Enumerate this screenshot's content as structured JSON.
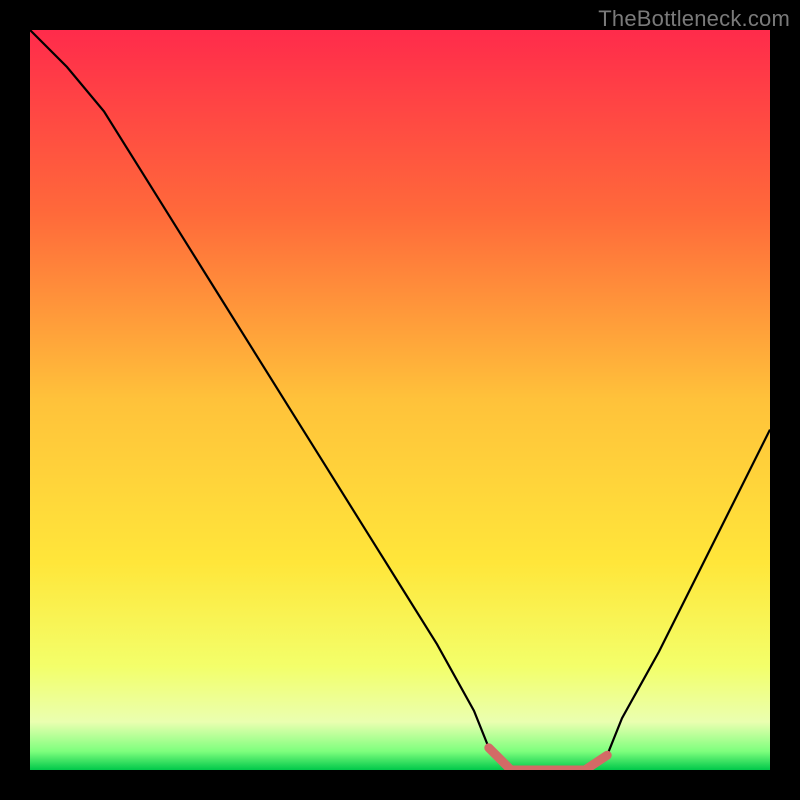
{
  "watermark": "TheBottleneck.com",
  "chart_data": {
    "type": "line",
    "title": "",
    "xlabel": "",
    "ylabel": "",
    "xlim": [
      0,
      100
    ],
    "ylim": [
      0,
      100
    ],
    "series": [
      {
        "name": "bottleneck-curve",
        "x": [
          0,
          5,
          10,
          15,
          20,
          25,
          30,
          35,
          40,
          45,
          50,
          55,
          60,
          62,
          65,
          70,
          75,
          78,
          80,
          85,
          90,
          95,
          100
        ],
        "y": [
          100,
          95,
          89,
          81,
          73,
          65,
          57,
          49,
          41,
          33,
          25,
          17,
          8,
          3,
          0,
          0,
          0,
          2,
          7,
          16,
          26,
          36,
          46
        ]
      },
      {
        "name": "optimal-band",
        "x": [
          62,
          65,
          70,
          75,
          78
        ],
        "y": [
          3,
          0,
          0,
          0,
          2
        ]
      }
    ],
    "gradient_stops": [
      {
        "offset": 0.0,
        "color": "#ff2b4b"
      },
      {
        "offset": 0.25,
        "color": "#ff6a3a"
      },
      {
        "offset": 0.5,
        "color": "#ffc23a"
      },
      {
        "offset": 0.72,
        "color": "#ffe63a"
      },
      {
        "offset": 0.86,
        "color": "#f3ff6a"
      },
      {
        "offset": 0.935,
        "color": "#eaffb0"
      },
      {
        "offset": 0.975,
        "color": "#7dff7d"
      },
      {
        "offset": 1.0,
        "color": "#00c84a"
      }
    ],
    "curve_color": "#000000",
    "band_color": "#d36a66",
    "band_width": 9
  }
}
